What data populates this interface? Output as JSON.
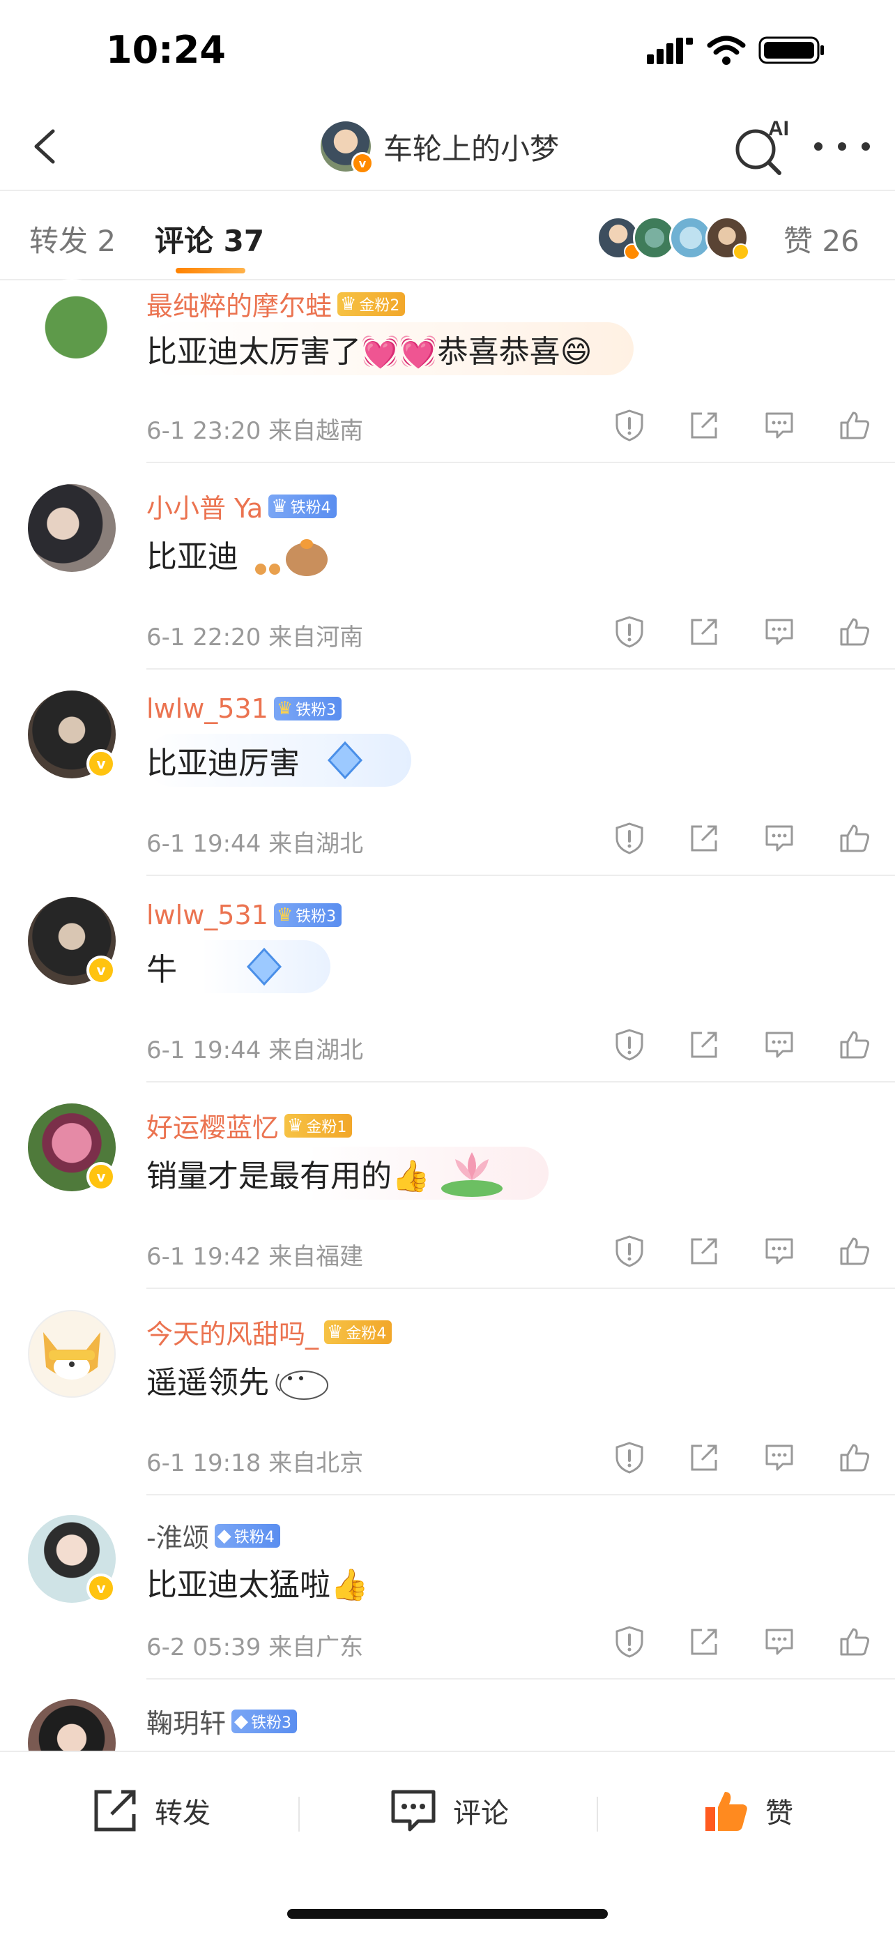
{
  "status_bar": {
    "time": "10:24"
  },
  "header": {
    "title": "车轮上的小梦",
    "ai_label": "AI"
  },
  "tabs": {
    "repost": "转发 2",
    "comments": "评论 37",
    "likes": "赞 26"
  },
  "comments": [
    {
      "username": "最纯粹的摩尔蛙",
      "badge": "金粉2",
      "badge_level": "4",
      "text": "比亚迪太厉害了💓💓恭喜恭喜😄",
      "date": "6-1 23:20",
      "location": "来自越南"
    },
    {
      "username": "小小普 Ya",
      "badge": "铁粉4",
      "badge_level": "",
      "text": "比亚迪",
      "date": "6-1 22:20",
      "location": "来自河南"
    },
    {
      "username": "lwlw_531",
      "badge": "铁粉3",
      "badge_level": "4",
      "text": "比亚迪厉害",
      "date": "6-1 19:44",
      "location": "来自湖北"
    },
    {
      "username": "lwlw_531",
      "badge": "铁粉3",
      "badge_level": "4",
      "text": "牛",
      "date": "6-1 19:44",
      "location": "来自湖北"
    },
    {
      "username": "好运樱蓝忆",
      "badge": "金粉1",
      "badge_level": "4",
      "text": "销量才是最有用的👍",
      "date": "6-1 19:42",
      "location": "来自福建"
    },
    {
      "username": "今天的风甜吗_",
      "badge": "金粉4",
      "badge_level": "5",
      "text": "遥遥领先",
      "date": "6-1 19:18",
      "location": "来自北京"
    },
    {
      "username": "-淮颂",
      "badge": "铁粉4",
      "badge_level": "",
      "text": "比亚迪太猛啦👍",
      "date": "6-2 05:39",
      "location": "来自广东"
    },
    {
      "username": "鞠玥轩",
      "badge": "铁粉3",
      "badge_level": "",
      "text": "",
      "date": "",
      "location": ""
    }
  ],
  "bottom_bar": {
    "repost": "转发",
    "comment": "评论",
    "like": "赞"
  },
  "colors": {
    "accent": "#ff8200",
    "username": "#eb7350",
    "like": "#ff6a14"
  }
}
